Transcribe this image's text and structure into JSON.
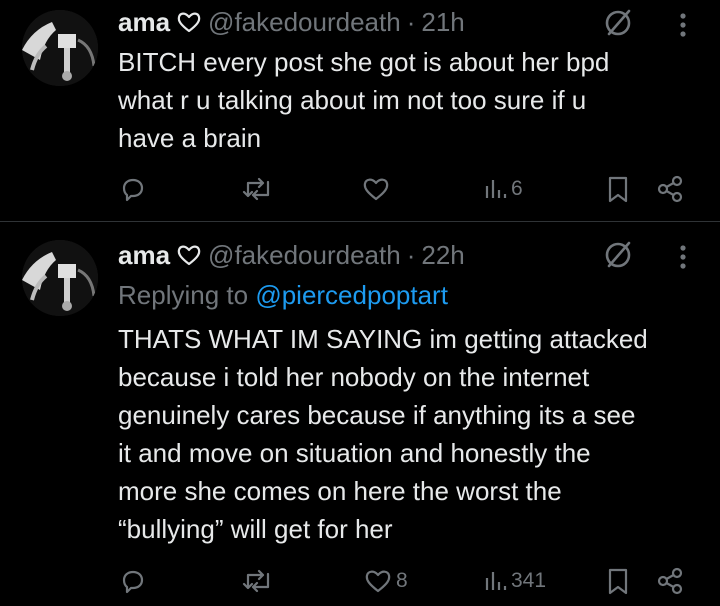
{
  "posts": [
    {
      "author_name": "ama",
      "handle": "@fakedourdeath",
      "separator": "·",
      "time": "21h",
      "lines": [
        "BITCH every post she got is about her bpd",
        "what r u talking about im not too sure if u",
        "have a brain"
      ],
      "views": "6",
      "likes": ""
    },
    {
      "author_name": "ama",
      "handle": "@fakedourdeath",
      "separator": "·",
      "time": "22h",
      "reply_prefix": "Replying to ",
      "reply_mention": "@piercedpoptart",
      "lines": [
        "THATS WHAT IM SAYING im getting attacked",
        "because i told her nobody on the internet",
        "genuinely cares because if anything its a see",
        "it and move on situation and honestly the",
        "more she comes on here the worst the",
        "“bullying” will get for her"
      ],
      "views": "341",
      "likes": "8"
    }
  ],
  "icons": {
    "reply": "reply-icon",
    "repost": "repost-icon",
    "like": "heart-icon",
    "views": "views-icon",
    "bookmark": "bookmark-icon",
    "share": "share-icon",
    "grok": "grok-icon",
    "more": "more-icon",
    "badge": "gray-heart-badge"
  },
  "colors": {
    "background": "#000000",
    "text": "#e7e9ea",
    "muted": "#71767b",
    "link": "#1d9bf0",
    "divider": "#2f3336"
  }
}
